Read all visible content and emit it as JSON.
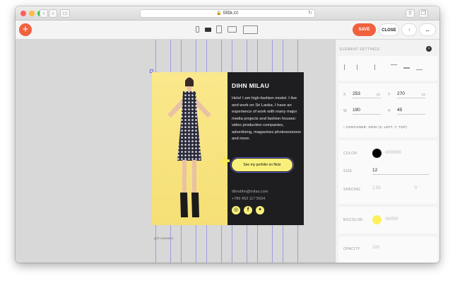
{
  "browser": {
    "url": "tilda.cc"
  },
  "toolbar": {
    "add_label": "+",
    "save_label": "SAVE",
    "close_label": "CLOSE",
    "publish_label": "↑",
    "more_label": "..."
  },
  "canvas": {
    "grid_container_label": "grid container"
  },
  "card": {
    "name": "DIHN MILAU",
    "bio": "Helo! I am high-fashion model. I live and work on Sri Lanka. I have an experience of work with many major media projects and fashion houses: video production companies, advertising, magazines photosessions and more.",
    "button_label": "See my porfolio on flickr",
    "email": "dihndihn@milau.com",
    "phone": "+786 453 117 5634",
    "social": [
      "instagram-icon",
      "facebook-icon",
      "twitter-icon"
    ],
    "accent_color": "#f8f07a"
  },
  "settings": {
    "title": "ELEMENT SETTINGS",
    "x_label": "X",
    "x_value": "253",
    "x_unit": "px",
    "y_label": "Y",
    "y_value": "270",
    "y_unit": "px",
    "w_label": "W",
    "w_value": "190",
    "h_label": "H",
    "h_value": "45",
    "container_text": "› CONTAINER: GRID (X: LEFT, Y: TOP)",
    "color_label": "COLOR",
    "color_value": "#000000",
    "color_swatch": "#000000",
    "size_label": "SIZE",
    "size_value": "12",
    "spacing_label": "SPACING",
    "spacing_value": "1.55",
    "spacing_value2": "0",
    "bgcolor_label": "BGCOLOR",
    "bgcolor_value": "#fcf05f",
    "bgcolor_swatch": "#fcf05f",
    "opacity_label": "OPACITY",
    "opacity_value": "100"
  }
}
